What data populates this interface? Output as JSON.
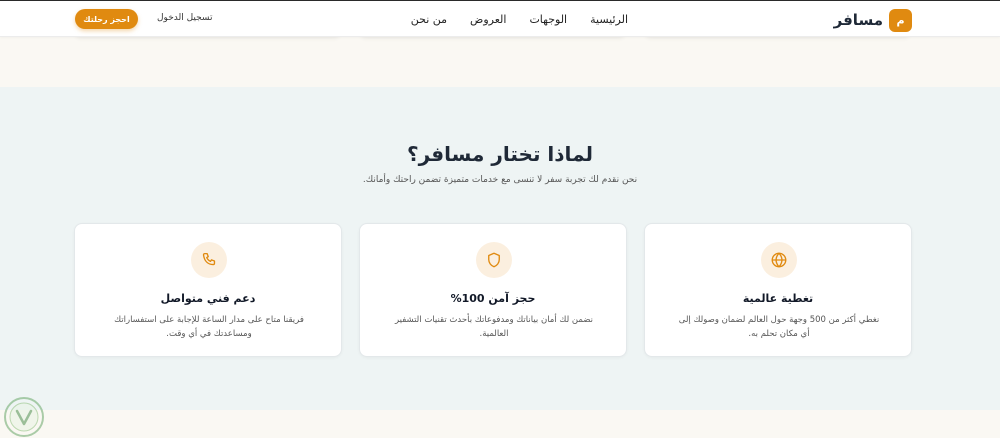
{
  "header": {
    "brand_mark": "م",
    "brand_name": "مسافر",
    "nav": [
      {
        "label": "الرئيسية"
      },
      {
        "label": "الوجهات"
      },
      {
        "label": "العروض"
      },
      {
        "label": "من نحن"
      }
    ],
    "login_label": "تسجيل الدخول",
    "book_label": "احجز رحلتك"
  },
  "why": {
    "title": "لماذا تختار مسافر؟",
    "subtitle": "نحن نقدم لك تجربة سفر لا تنسى مع خدمات متميزة تضمن راحتك وأمانك.",
    "cards": [
      {
        "icon": "globe-icon",
        "title": "تغطية عالمية",
        "description": "نغطي أكثر من 500 وجهة حول العالم لضمان وصولك إلى أي مكان تحلم به."
      },
      {
        "icon": "shield-icon",
        "title": "حجز آمن 100%",
        "description": "نضمن لك أمان بياناتك ومدفوعاتك بأحدث تقنيات التشفير العالمية."
      },
      {
        "icon": "phone-icon",
        "title": "دعم فني متواصل",
        "description": "فريقنا متاح على مدار الساعة للإجابة على استفساراتك ومساعدتك في أي وقت."
      }
    ]
  },
  "colors": {
    "accent": "#e08a10",
    "icon_bg": "#fbefdf",
    "section_bg": "#eef4f4",
    "cream_bg": "#faf8f3"
  }
}
